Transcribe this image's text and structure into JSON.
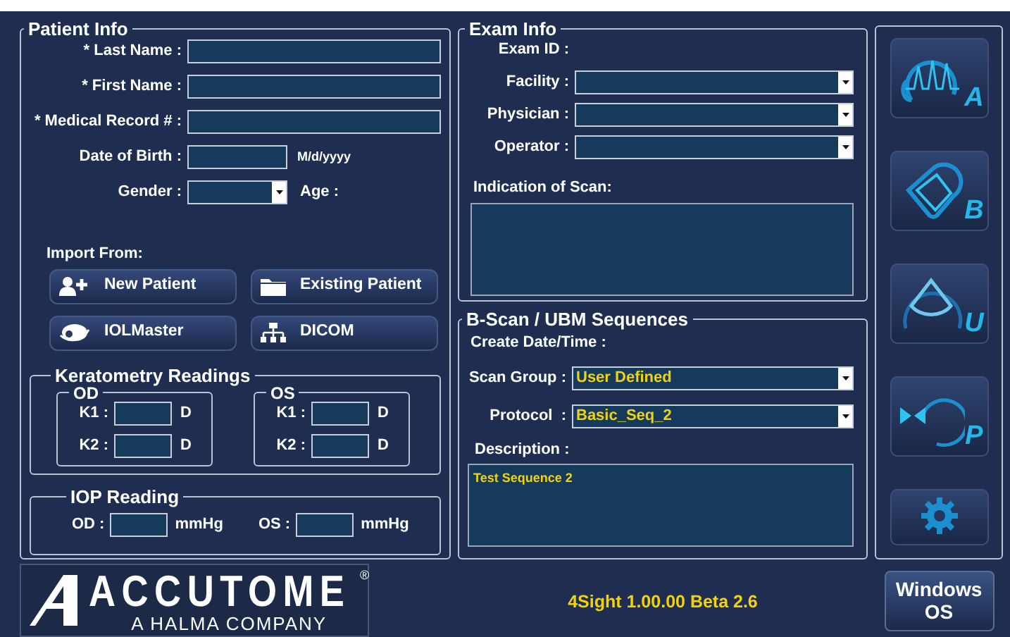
{
  "patient_info": {
    "title": "Patient Info",
    "fields": [
      {
        "label": "* Last Name :",
        "kind": "text"
      },
      {
        "label": "* First Name :",
        "kind": "text"
      },
      {
        "label": "* Medical Record # :",
        "kind": "text"
      },
      {
        "label": "Date of Birth :",
        "kind": "date",
        "format": "M/d/yyyy"
      },
      {
        "label": "Gender :",
        "kind": "select",
        "side_label": "Age :"
      }
    ],
    "import_label": "Import From:",
    "import_buttons": [
      {
        "label": "New Patient"
      },
      {
        "label": "Existing Patient"
      },
      {
        "label": "IOLMaster"
      },
      {
        "label": "DICOM"
      }
    ],
    "keratometry": {
      "title": "Keratometry Readings",
      "eyes": [
        {
          "title": "OD",
          "rows": [
            {
              "label": "K1 :",
              "unit": "D"
            },
            {
              "label": "K2 :",
              "unit": "D"
            }
          ]
        },
        {
          "title": "OS",
          "rows": [
            {
              "label": "K1 :",
              "unit": "D"
            },
            {
              "label": "K2 :",
              "unit": "D"
            }
          ]
        }
      ]
    },
    "iop": {
      "title": "IOP Reading",
      "items": [
        {
          "label": "OD :",
          "unit": "mmHg"
        },
        {
          "label": "OS :",
          "unit": "mmHg"
        }
      ]
    }
  },
  "exam_info": {
    "title": "Exam Info",
    "exam_id_label": "Exam ID :",
    "fields": [
      {
        "label": "Facility :"
      },
      {
        "label": "Physician :"
      },
      {
        "label": "Operator :"
      }
    ],
    "indication_label": "Indication of Scan:"
  },
  "sequences": {
    "title": "B-Scan / UBM Sequences",
    "create_label": "Create Date/Time :",
    "fields": [
      {
        "label": "Scan Group :",
        "value": "User Defined"
      },
      {
        "label": "Protocol  :",
        "value": "Basic_Seq_2"
      }
    ],
    "description_label": "Description :",
    "description": "Test Sequence 2"
  },
  "modes": [
    {
      "letter": "A"
    },
    {
      "letter": "B"
    },
    {
      "letter": "U"
    },
    {
      "letter": "P"
    }
  ],
  "footer": {
    "logo": {
      "name": "ACCUTOME",
      "mark": "®",
      "tagline": "A HALMA COMPANY"
    },
    "version": "4Sight 1.00.00 Beta 2.6",
    "windows_button": "Windows OS"
  }
}
